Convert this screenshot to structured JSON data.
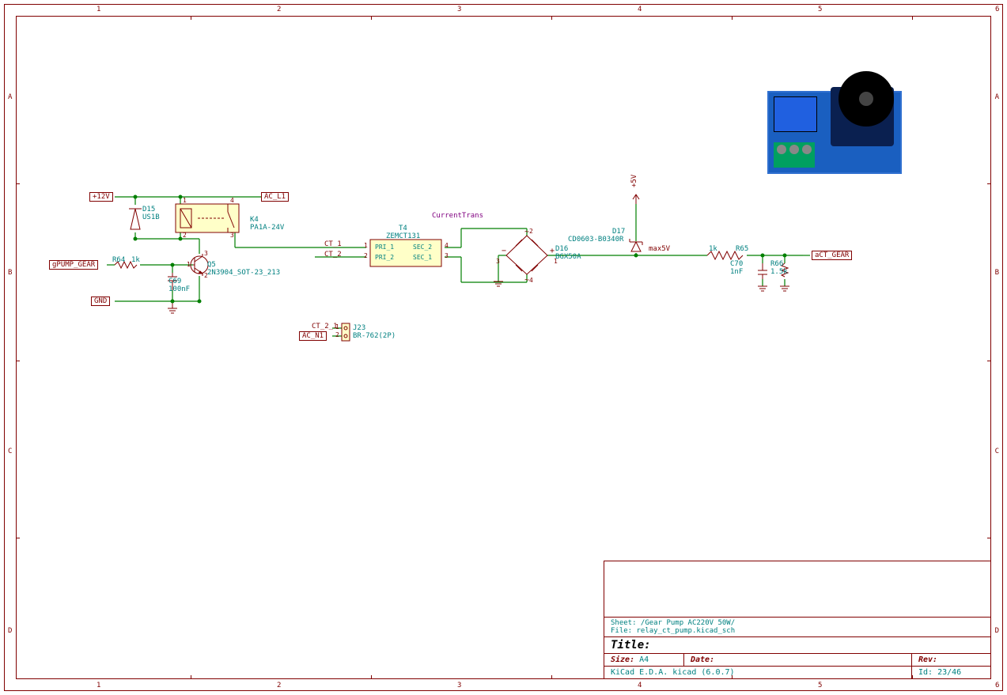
{
  "titleblock": {
    "sheet": "Sheet: /Gear Pump AC220V 50W/",
    "file": "File: relay_ct_pump.kicad_sch",
    "title_label": "Title:",
    "size_label": "Size:",
    "size_value": "A4",
    "date_label": "Date:",
    "date_value": "",
    "rev_label": "Rev:",
    "rev_value": "",
    "kicad": "KiCad E.D.A.  kicad (6.0.7)",
    "id": "Id: 23/46"
  },
  "grid": {
    "cols": [
      "1",
      "2",
      "3",
      "4",
      "5",
      "6"
    ],
    "rows": [
      "A",
      "B",
      "C",
      "D"
    ]
  },
  "labels": {
    "p12v": "+12V",
    "ac_l1": "AC_L1",
    "p5v": "+5V",
    "gnd": "GND",
    "gpump": "gPUMP_GEAR",
    "act_gear": "aCT_GEAR",
    "ac_n1": "AC_N1",
    "ct_1": "CT_1",
    "ct_2": "CT_2",
    "ct_2_1": "CT_2_1",
    "max5v": "max5V",
    "currenttrans": "CurrentTrans"
  },
  "components": {
    "D15": {
      "ref": "D15",
      "val": "US1B"
    },
    "K4": {
      "ref": "K4",
      "val": "PA1A-24V"
    },
    "R64": {
      "ref": "R64",
      "val": "1k"
    },
    "C69": {
      "ref": "C69",
      "val": "100nF"
    },
    "Q5": {
      "ref": "Q5",
      "val": "2N3904_SOT-23_213"
    },
    "T4": {
      "ref": "T4",
      "val": "ZEMCT131",
      "p1": "PRI_1",
      "p2": "PRI_2",
      "s1": "SEC_1",
      "s2": "SEC_2"
    },
    "D16": {
      "ref": "D16",
      "val": "BGX50A"
    },
    "D17": {
      "ref": "D17",
      "val": "CD0603-B0340R"
    },
    "R65": {
      "ref": "R65",
      "val": "1k"
    },
    "C70": {
      "ref": "C70",
      "val": "1nF"
    },
    "R66": {
      "ref": "R66",
      "val": "1.5k"
    },
    "J23": {
      "ref": "J23",
      "val": "BR-762(2P)"
    }
  },
  "pins": {
    "t4_1": "1",
    "t4_2": "2",
    "t4_3": "3",
    "t4_4": "4",
    "d16_1": "1",
    "d16_2": "2",
    "d16_3": "3",
    "d16_4": "4",
    "j23_1": "1",
    "j23_2": "2",
    "k4_1": "1",
    "k4_2": "2",
    "k4_3": "3",
    "k4_4": "4",
    "q5_1": "1",
    "q5_2": "2",
    "q5_3": "3"
  }
}
